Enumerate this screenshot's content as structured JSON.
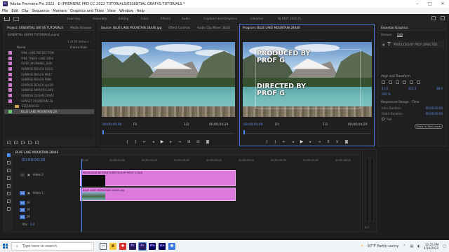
{
  "window": {
    "title": "Adobe Premiere Pro 2022 - D:\\PREMIERE PRO CC 2022 TUTORIALS\\ESSENTIAL GRAFXS TUTORIALS *"
  },
  "menu": [
    "File",
    "Edit",
    "Clip",
    "Sequence",
    "Markers",
    "Graphics and Titles",
    "View",
    "Window",
    "Help"
  ],
  "workspaces": [
    "Learning",
    "Assembly",
    "Editing",
    "Color",
    "Effects",
    "Audio",
    "Captions and Graphics",
    "Libraries",
    "NJ EDIT 2022 FL"
  ],
  "project": {
    "tabs": [
      "Project: ESSENTIAL GRFXS TUTORIALS",
      "Media Browser"
    ],
    "path": "ESSENTIAL GRFXS TUTORIALS.prproj",
    "count": "1 of 19 items s...",
    "col_name": "Name",
    "col_rate": "Frame Rate",
    "items": [
      {
        "label": "PINK LAKE REFLECTION",
        "color": "#d07bd0"
      },
      {
        "label": "PINE TREES LAKE 2694",
        "color": "#d07bd0"
      },
      {
        "label": "RIVER_MORNING_SUN",
        "color": "#d07bd0"
      },
      {
        "label": "SUNRISE BEACH GOLD",
        "color": "#d07bd0"
      },
      {
        "label": "SUNRISE BEACH MULT",
        "color": "#d07bd0"
      },
      {
        "label": "SUNRISE BEACH PINK",
        "color": "#d07bd0"
      },
      {
        "label": "SUNRISE BEACH xyz28",
        "color": "#d07bd0"
      },
      {
        "label": "SUNRISE MIRROR LAKE",
        "color": "#d07bd0"
      },
      {
        "label": "SUNRISE OCEAN 29942",
        "color": "#d07bd0"
      },
      {
        "label": "SUNSET MOUNTAIN 28",
        "color": "#d07bd0"
      }
    ],
    "folder": "SEQUENCES",
    "selected": "BLUE LAKE MOUNTAIN 28"
  },
  "source": {
    "tabs": [
      "Source: BLUE LAKE MOUNTAIN 28446.jpg",
      "Effect Controls",
      "Audio Clip Mixer: BLUE"
    ],
    "timecode": "00;00;00;00",
    "fit": "Fit",
    "page": "1/2",
    "duration": "00;00;04;29"
  },
  "program": {
    "tab": "Program: BLUE LAKE MOUNTAIN 28446",
    "overlay_line1": "PRODUCED BY",
    "overlay_line2": "PROF G",
    "overlay_line3": "DIRECTED BY",
    "overlay_line4": "PROF G",
    "timecode": "00;00;00;00",
    "fit": "Fit",
    "page": "1/2",
    "duration": "00;00;04;29"
  },
  "essential_graphics": {
    "title": "Essential Graphics",
    "subtabs": [
      "Browse",
      "Edit"
    ],
    "layer": "PRODUCED BY PROF DIRECTED",
    "sect_align": "Align and Transform",
    "transform_vals": [
      "41.8",
      "131.9",
      "88.9"
    ],
    "scale": "100 %",
    "sect_responsive": "Responsive Design – Time",
    "intro_label": "Intro Duration",
    "intro_val": "00;00;00;00",
    "outro_label": "Outro Duration",
    "outro_val": "00;00;00;00",
    "roll_label": "Roll",
    "show_btn": "Show in Text panel"
  },
  "timeline": {
    "tab": "BLUE LAKE MOUNTAIN 28446",
    "timecode": "00;00;00;00",
    "ruler": [
      "00;00",
      "00;00;01;00",
      "00;00;02;00",
      "00;00;03;00",
      "00;00;04;00",
      "00;00;05;00",
      "00;00;06;00",
      "00;00;07;00",
      "00;00;08;00"
    ],
    "tracks": {
      "v2": "V2",
      "v2_name": "Video 2",
      "v1": "V1",
      "v1_name": "Video 1",
      "a1": "A1",
      "a2": "A2",
      "a3": "A3",
      "mix": "Mix",
      "mix_val": "0.0"
    },
    "clip_v2": "PRODUCED BY PROF DIRECTED BY PROF G END",
    "clip_v1": "BLUE LAKE MOUNTAIN 28446.jpg"
  },
  "taskbar": {
    "search_placeholder": "Type here to search",
    "weather": "67°F Partly sunny",
    "time": "12:25 PM",
    "date": "4/16/2022"
  },
  "colors": {
    "accent": "#4d8bf0",
    "clip": "#dc7adc",
    "panel": "#1f1f1f"
  }
}
